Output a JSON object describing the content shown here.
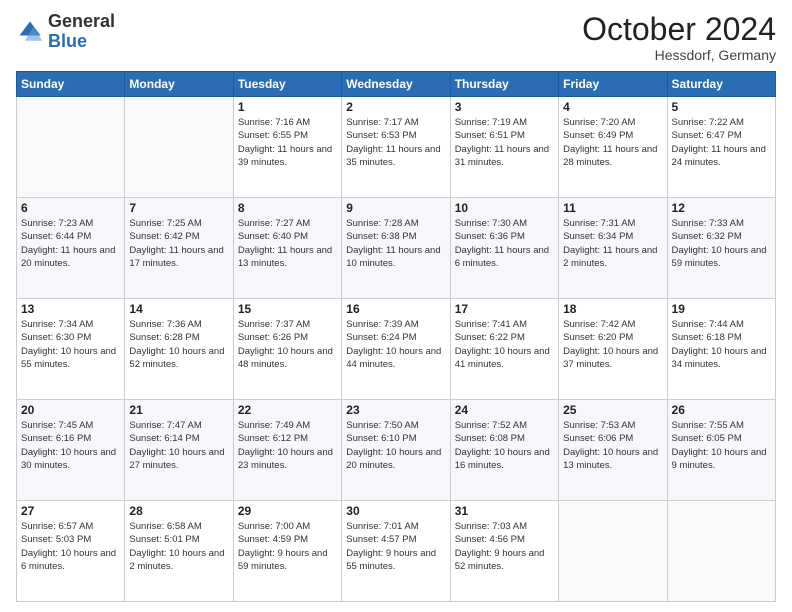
{
  "logo": {
    "general": "General",
    "blue": "Blue"
  },
  "header": {
    "month": "October 2024",
    "location": "Hessdorf, Germany"
  },
  "weekdays": [
    "Sunday",
    "Monday",
    "Tuesday",
    "Wednesday",
    "Thursday",
    "Friday",
    "Saturday"
  ],
  "weeks": [
    [
      null,
      null,
      {
        "day": 1,
        "sunrise": "7:16 AM",
        "sunset": "6:55 PM",
        "daylight": "11 hours and 39 minutes."
      },
      {
        "day": 2,
        "sunrise": "7:17 AM",
        "sunset": "6:53 PM",
        "daylight": "11 hours and 35 minutes."
      },
      {
        "day": 3,
        "sunrise": "7:19 AM",
        "sunset": "6:51 PM",
        "daylight": "11 hours and 31 minutes."
      },
      {
        "day": 4,
        "sunrise": "7:20 AM",
        "sunset": "6:49 PM",
        "daylight": "11 hours and 28 minutes."
      },
      {
        "day": 5,
        "sunrise": "7:22 AM",
        "sunset": "6:47 PM",
        "daylight": "11 hours and 24 minutes."
      }
    ],
    [
      {
        "day": 6,
        "sunrise": "7:23 AM",
        "sunset": "6:44 PM",
        "daylight": "11 hours and 20 minutes."
      },
      {
        "day": 7,
        "sunrise": "7:25 AM",
        "sunset": "6:42 PM",
        "daylight": "11 hours and 17 minutes."
      },
      {
        "day": 8,
        "sunrise": "7:27 AM",
        "sunset": "6:40 PM",
        "daylight": "11 hours and 13 minutes."
      },
      {
        "day": 9,
        "sunrise": "7:28 AM",
        "sunset": "6:38 PM",
        "daylight": "11 hours and 10 minutes."
      },
      {
        "day": 10,
        "sunrise": "7:30 AM",
        "sunset": "6:36 PM",
        "daylight": "11 hours and 6 minutes."
      },
      {
        "day": 11,
        "sunrise": "7:31 AM",
        "sunset": "6:34 PM",
        "daylight": "11 hours and 2 minutes."
      },
      {
        "day": 12,
        "sunrise": "7:33 AM",
        "sunset": "6:32 PM",
        "daylight": "10 hours and 59 minutes."
      }
    ],
    [
      {
        "day": 13,
        "sunrise": "7:34 AM",
        "sunset": "6:30 PM",
        "daylight": "10 hours and 55 minutes."
      },
      {
        "day": 14,
        "sunrise": "7:36 AM",
        "sunset": "6:28 PM",
        "daylight": "10 hours and 52 minutes."
      },
      {
        "day": 15,
        "sunrise": "7:37 AM",
        "sunset": "6:26 PM",
        "daylight": "10 hours and 48 minutes."
      },
      {
        "day": 16,
        "sunrise": "7:39 AM",
        "sunset": "6:24 PM",
        "daylight": "10 hours and 44 minutes."
      },
      {
        "day": 17,
        "sunrise": "7:41 AM",
        "sunset": "6:22 PM",
        "daylight": "10 hours and 41 minutes."
      },
      {
        "day": 18,
        "sunrise": "7:42 AM",
        "sunset": "6:20 PM",
        "daylight": "10 hours and 37 minutes."
      },
      {
        "day": 19,
        "sunrise": "7:44 AM",
        "sunset": "6:18 PM",
        "daylight": "10 hours and 34 minutes."
      }
    ],
    [
      {
        "day": 20,
        "sunrise": "7:45 AM",
        "sunset": "6:16 PM",
        "daylight": "10 hours and 30 minutes."
      },
      {
        "day": 21,
        "sunrise": "7:47 AM",
        "sunset": "6:14 PM",
        "daylight": "10 hours and 27 minutes."
      },
      {
        "day": 22,
        "sunrise": "7:49 AM",
        "sunset": "6:12 PM",
        "daylight": "10 hours and 23 minutes."
      },
      {
        "day": 23,
        "sunrise": "7:50 AM",
        "sunset": "6:10 PM",
        "daylight": "10 hours and 20 minutes."
      },
      {
        "day": 24,
        "sunrise": "7:52 AM",
        "sunset": "6:08 PM",
        "daylight": "10 hours and 16 minutes."
      },
      {
        "day": 25,
        "sunrise": "7:53 AM",
        "sunset": "6:06 PM",
        "daylight": "10 hours and 13 minutes."
      },
      {
        "day": 26,
        "sunrise": "7:55 AM",
        "sunset": "6:05 PM",
        "daylight": "10 hours and 9 minutes."
      }
    ],
    [
      {
        "day": 27,
        "sunrise": "6:57 AM",
        "sunset": "5:03 PM",
        "daylight": "10 hours and 6 minutes."
      },
      {
        "day": 28,
        "sunrise": "6:58 AM",
        "sunset": "5:01 PM",
        "daylight": "10 hours and 2 minutes."
      },
      {
        "day": 29,
        "sunrise": "7:00 AM",
        "sunset": "4:59 PM",
        "daylight": "9 hours and 59 minutes."
      },
      {
        "day": 30,
        "sunrise": "7:01 AM",
        "sunset": "4:57 PM",
        "daylight": "9 hours and 55 minutes."
      },
      {
        "day": 31,
        "sunrise": "7:03 AM",
        "sunset": "4:56 PM",
        "daylight": "9 hours and 52 minutes."
      },
      null,
      null
    ]
  ]
}
